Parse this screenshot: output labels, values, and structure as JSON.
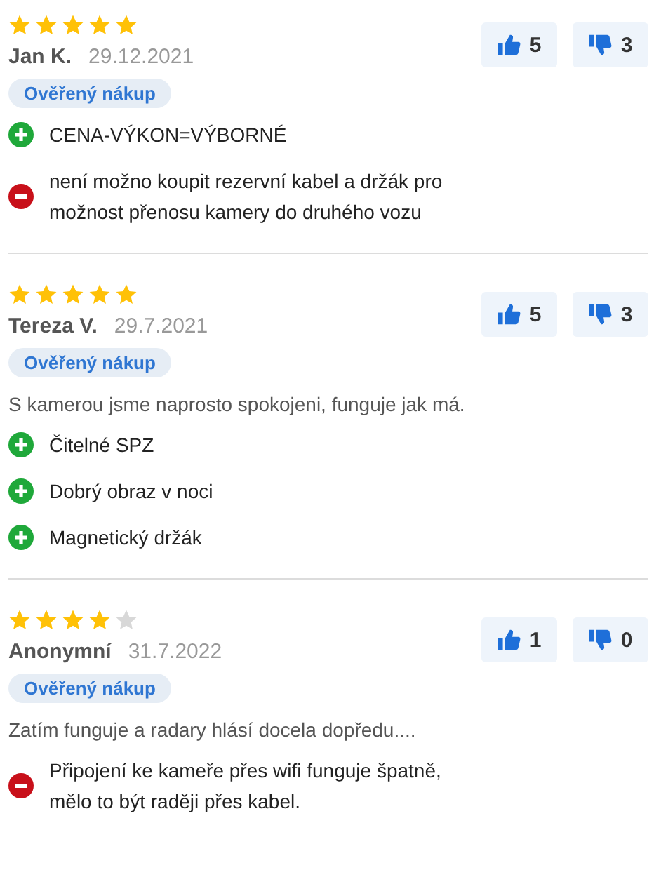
{
  "reviews": [
    {
      "stars": 5,
      "author": "Jan K.",
      "date": "29.12.2021",
      "badge": "Ověřený nákup",
      "likes": "5",
      "dislikes": "3",
      "items": [
        {
          "kind": "pro",
          "text": "CENA-VÝKON=VÝBORNÉ"
        },
        {
          "kind": "con",
          "text": "není možno koupit rezervní kabel a držák pro možnost přenosu kamery do druhého vozu"
        }
      ]
    },
    {
      "stars": 5,
      "author": "Tereza V.",
      "date": "29.7.2021",
      "badge": "Ověřený nákup",
      "likes": "5",
      "dislikes": "3",
      "comment": "S kamerou jsme naprosto spokojeni, funguje jak má.",
      "items": [
        {
          "kind": "pro",
          "text": "Čitelné SPZ"
        },
        {
          "kind": "pro",
          "text": "Dobrý obraz v noci"
        },
        {
          "kind": "pro",
          "text": "Magnetický držák"
        }
      ]
    },
    {
      "stars": 4,
      "author": "Anonymní",
      "date": "31.7.2022",
      "badge": "Ověřený nákup",
      "likes": "1",
      "dislikes": "0",
      "comment": "Zatím funguje a radary hlásí docela dopředu....",
      "items": [
        {
          "kind": "con",
          "text": "Připojení ke kameře přes wifi funguje špatně, mělo to být raději přes kabel."
        }
      ]
    }
  ]
}
